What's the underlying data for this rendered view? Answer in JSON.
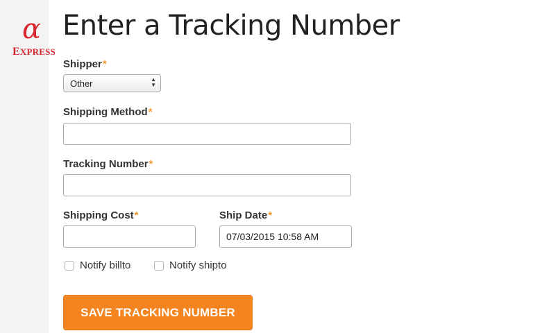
{
  "brand": {
    "logo_symbol": "α",
    "logo_text_first": "E",
    "logo_text_rest": "XPRESS",
    "accent_color": "#d7262f"
  },
  "header": {
    "title": "Enter a Tracking Number"
  },
  "form": {
    "required_marker": "*",
    "required_color": "#f39a34",
    "shipper": {
      "label": "Shipper",
      "selected_value": "Other"
    },
    "shipping_method": {
      "label": "Shipping Method",
      "value": ""
    },
    "tracking_number": {
      "label": "Tracking Number",
      "value": ""
    },
    "shipping_cost": {
      "label": "Shipping Cost",
      "value": ""
    },
    "ship_date": {
      "label": "Ship Date",
      "value": "07/03/2015 10:58 AM"
    },
    "checkboxes": [
      {
        "label": "Notify billto",
        "checked": false
      },
      {
        "label": "Notify shipto",
        "checked": false
      }
    ],
    "save_button": {
      "label": "SAVE TRACKING NUMBER",
      "color": "#f48420"
    }
  }
}
